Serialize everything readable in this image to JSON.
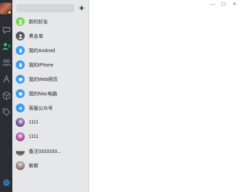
{
  "search": {
    "value": "",
    "placeholder": ""
  },
  "add_button": {
    "label": "+"
  },
  "contacts": [
    {
      "label": "新的好友",
      "icon": "add-friend-icon",
      "color": "#7ed65a"
    },
    {
      "label": "黑名单",
      "icon": "blacklist-icon",
      "color": "#555a60"
    },
    {
      "label": "我的Android",
      "icon": "android-device-icon",
      "color": "#3d9df5"
    },
    {
      "label": "我的iPhone",
      "icon": "iphone-device-icon",
      "color": "#3d9df5"
    },
    {
      "label": "我的Web网页",
      "icon": "web-device-icon",
      "color": "#3d9df5"
    },
    {
      "label": "我的Mac电脑",
      "icon": "mac-device-icon",
      "color": "#3d9df5"
    },
    {
      "label": "客服公众号",
      "icon": "service-account-icon",
      "color": "#3d9df5"
    },
    {
      "label": "1111",
      "icon": "user-avatar",
      "color": "#6b4f8a"
    },
    {
      "label": "1111",
      "icon": "user-avatar",
      "color": "#b45aa5"
    },
    {
      "label": "备注3333333...",
      "icon": "user-avatar",
      "color": "#8a7f76"
    },
    {
      "label": "斯斯",
      "icon": "user-avatar",
      "color": "#9a8c86"
    }
  ],
  "rail": {
    "items": [
      {
        "icon": "chat-icon",
        "active": false
      },
      {
        "icon": "contacts-icon",
        "active": true
      },
      {
        "icon": "groups-icon",
        "active": false
      },
      {
        "icon": "explore-icon",
        "active": false
      },
      {
        "icon": "box-icon",
        "active": false
      },
      {
        "icon": "tag-icon",
        "active": false
      }
    ],
    "settings_icon": "gear-icon"
  },
  "window": {
    "minimize": "—",
    "maximize": "☐",
    "close": "✕"
  },
  "colors": {
    "rail": "#2a2d33",
    "active": "#2fc46b",
    "panel": "#e6e7e9",
    "accent": "#3d9df5"
  }
}
